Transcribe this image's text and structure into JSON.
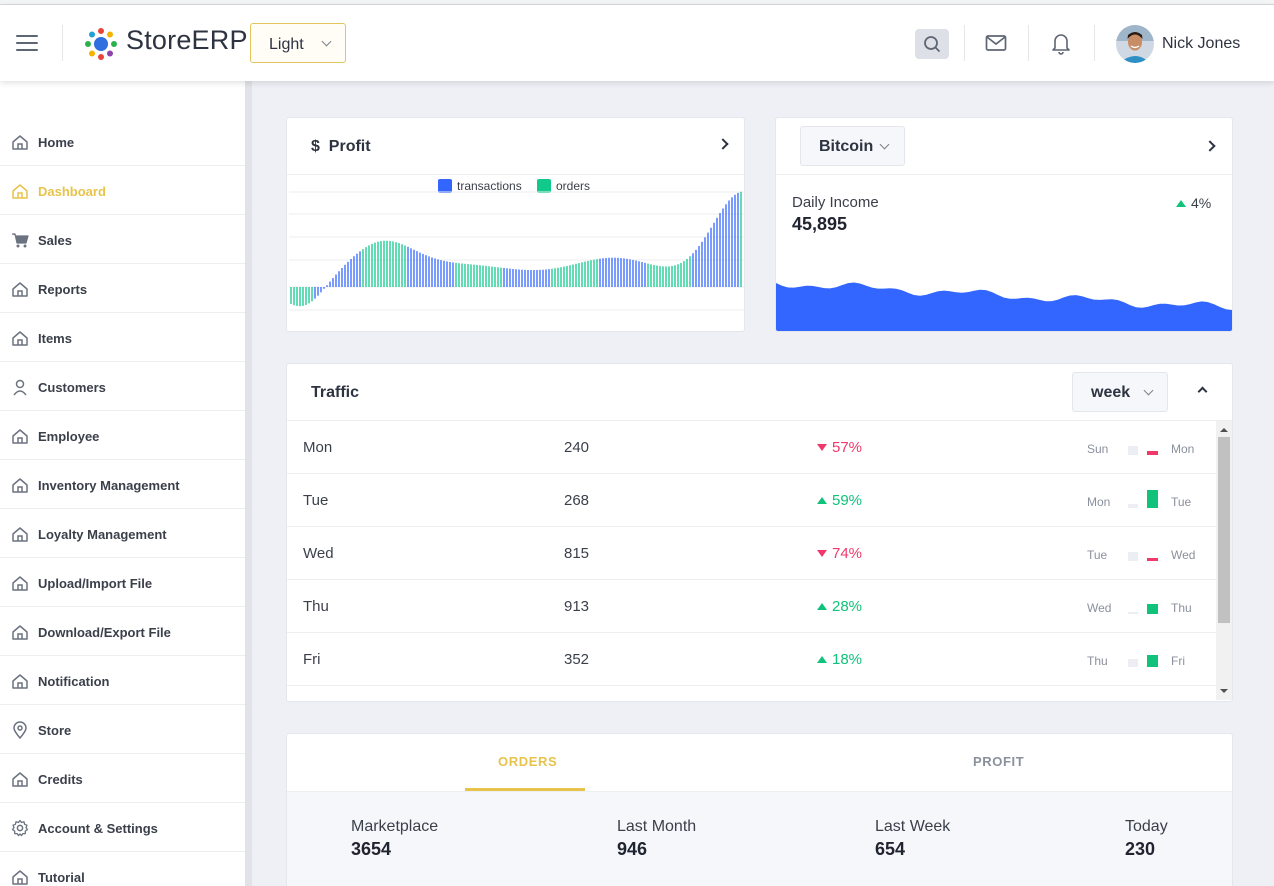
{
  "header": {
    "brand": "StoreERP",
    "theme_value": "Light",
    "user_name": "Nick Jones"
  },
  "sidebar": {
    "items": [
      {
        "label": "Home",
        "icon": "home-icon",
        "active": false
      },
      {
        "label": "Dashboard",
        "icon": "home-icon",
        "active": true
      },
      {
        "label": "Sales",
        "icon": "cart-icon",
        "active": false
      },
      {
        "label": "Reports",
        "icon": "home-icon",
        "active": false
      },
      {
        "label": "Items",
        "icon": "home-icon",
        "active": false
      },
      {
        "label": "Customers",
        "icon": "user-icon",
        "active": false
      },
      {
        "label": "Employee",
        "icon": "home-icon",
        "active": false
      },
      {
        "label": "Inventory Management",
        "icon": "home-icon",
        "active": false
      },
      {
        "label": "Loyalty Management",
        "icon": "home-icon",
        "active": false
      },
      {
        "label": "Upload/Import File",
        "icon": "home-icon",
        "active": false
      },
      {
        "label": "Download/Export File",
        "icon": "home-icon",
        "active": false
      },
      {
        "label": "Notification",
        "icon": "home-icon",
        "active": false
      },
      {
        "label": "Store",
        "icon": "map-pin-icon",
        "active": false
      },
      {
        "label": "Credits",
        "icon": "home-icon",
        "active": false
      },
      {
        "label": "Account & Settings",
        "icon": "gear-icon",
        "active": false
      },
      {
        "label": "Tutorial",
        "icon": "home-icon",
        "active": false
      }
    ]
  },
  "profit_card": {
    "currency_symbol": "$",
    "title": "Profit",
    "legend": [
      {
        "label": "transactions",
        "color": "#3366ff"
      },
      {
        "label": "orders",
        "color": "#10c98a"
      }
    ]
  },
  "bitcoin_card": {
    "select_value": "Bitcoin",
    "label": "Daily Income",
    "value": "45,895",
    "change": "4%",
    "area_color": "#3366ff"
  },
  "traffic": {
    "title": "Traffic",
    "period": "week",
    "rows": [
      {
        "day": "Mon",
        "value": "240",
        "pct": "57%",
        "dir": "down",
        "prev": "Sun",
        "curr": "Mon",
        "prev_level": 0.45,
        "curr_level": 0.18
      },
      {
        "day": "Tue",
        "value": "268",
        "pct": "59%",
        "dir": "up",
        "prev": "Mon",
        "curr": "Tue",
        "prev_level": 0.18,
        "curr_level": 0.9
      },
      {
        "day": "Wed",
        "value": "815",
        "pct": "74%",
        "dir": "down",
        "prev": "Tue",
        "curr": "Wed",
        "prev_level": 0.45,
        "curr_level": 0.15
      },
      {
        "day": "Thu",
        "value": "913",
        "pct": "28%",
        "dir": "up",
        "prev": "Wed",
        "curr": "Thu",
        "prev_level": 0.12,
        "curr_level": 0.5
      },
      {
        "day": "Fri",
        "value": "352",
        "pct": "18%",
        "dir": "up",
        "prev": "Thu",
        "curr": "Fri",
        "prev_level": 0.4,
        "curr_level": 0.6
      }
    ]
  },
  "orders_panel": {
    "tabs": [
      "ORDERS",
      "PROFIT"
    ],
    "active_tab": "ORDERS",
    "stats": [
      {
        "label": "Marketplace",
        "value": "3654"
      },
      {
        "label": "Last Month",
        "value": "946"
      },
      {
        "label": "Last Week",
        "value": "654"
      },
      {
        "label": "Today",
        "value": "230"
      }
    ]
  },
  "colors": {
    "accent": "#e8c34c",
    "up": "#10c27a",
    "down": "#f0386b",
    "blue": "#3366ff"
  }
}
